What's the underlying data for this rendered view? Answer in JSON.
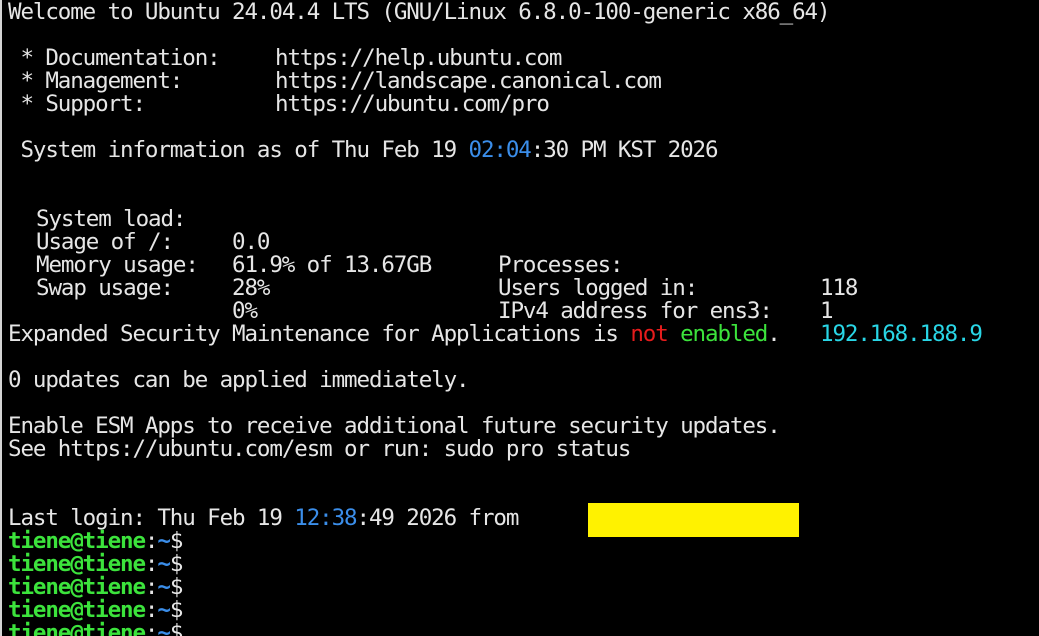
{
  "welcome": "Welcome to Ubuntu 24.04.4 LTS (GNU/Linux 6.8.0-100-generic x86_64)",
  "links": [
    {
      "label": " * Documentation:",
      "url": "https://help.ubuntu.com"
    },
    {
      "label": " * Management:",
      "url": "https://landscape.canonical.com"
    },
    {
      "label": " * Support:",
      "url": "https://ubuntu.com/pro"
    }
  ],
  "sysinfo": {
    "prefix": " System information as of Thu Feb 19 ",
    "time_hm": "02:04",
    "suffix": ":30 PM KST 2026"
  },
  "stats_left": [
    {
      "label": "System load:",
      "value": "0.0"
    },
    {
      "label": "Usage of /:",
      "value": "61.9% of 13.67GB"
    },
    {
      "label": "Memory usage:",
      "value": "28%"
    },
    {
      "label": "Swap usage:",
      "value": "0%"
    }
  ],
  "stats_right": [
    {
      "label": "Processes:",
      "value": "118"
    },
    {
      "label": "Users logged in:",
      "value": "1"
    },
    {
      "label": "IPv4 address for ens3:",
      "value": "192.168.188.9"
    }
  ],
  "esm": {
    "prefix": "Expanded Security Maintenance for Applications is ",
    "not": "not",
    "enabled": "enabled",
    "suffix": "."
  },
  "updates": "0 updates can be applied immediately.",
  "esm_enable": "Enable ESM Apps to receive additional future security updates.",
  "esm_see": "See https://ubuntu.com/esm or run: sudo pro status",
  "last_login": {
    "prefix": "Last login: Thu Feb 19 ",
    "time_hm": "12:38",
    "suffix": ":49 2026 from "
  },
  "prompt": {
    "user": "tiene@tiene",
    "sep": ":",
    "path": "~",
    "symbol": "$"
  },
  "colors": {
    "background": "#000000",
    "text": "#e6e6e6",
    "time_blue": "#3b8eea",
    "ip_cyan": "#29d6e6",
    "not_red": "#e61c1c",
    "prompt_green": "#3ce33c",
    "redaction_yellow": "#fff200"
  }
}
